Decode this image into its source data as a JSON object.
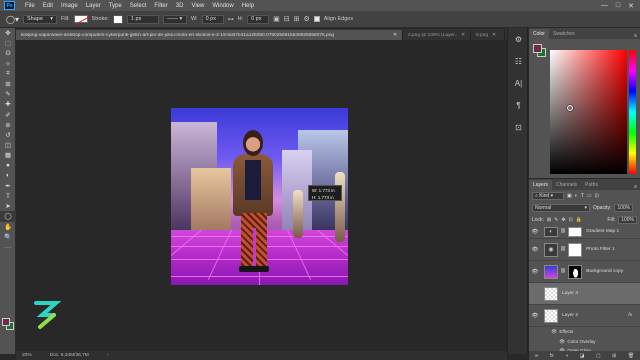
{
  "app": {
    "logo_text": "Ps"
  },
  "menu": {
    "items": [
      "File",
      "Edit",
      "Image",
      "Layer",
      "Type",
      "Select",
      "Filter",
      "3D",
      "View",
      "Window",
      "Help"
    ],
    "window_controls": [
      "—",
      "□",
      "✕"
    ]
  },
  "options": {
    "mode": "Shape",
    "fill_label": "Fill:",
    "stroke_label": "Stroke:",
    "stroke_width": "1 px",
    "w_label": "W:",
    "w_value": "0 px",
    "h_label": "H:",
    "h_value": "0 px",
    "align_edges": "Align Edges"
  },
  "tabs": [
    {
      "label": "kisspng-vaporwave-desktop-computers-cyberpunk-glitch-art-pin-de-jolou-moto-en-stickos-e-2-19-5d47e41a125050.0750256815649925558075.png",
      "active": true
    },
    {
      "label": "2.png @ 100% (Layer...",
      "active": false
    },
    {
      "label": "9.png",
      "active": false
    }
  ],
  "tools": [
    "move-tool",
    "marquee-tool",
    "lasso-tool",
    "quick-select-tool",
    "crop-tool",
    "frame-tool",
    "eyedropper-tool",
    "healing-brush-tool",
    "brush-tool",
    "clone-stamp-tool",
    "history-brush-tool",
    "eraser-tool",
    "gradient-tool",
    "blur-tool",
    "dodge-tool",
    "pen-tool",
    "type-tool",
    "path-select-tool",
    "ellipse-tool",
    "hand-tool",
    "zoom-tool",
    "more-tools"
  ],
  "tool_glyphs": [
    "✥",
    "⬚",
    "ʘ",
    "✧",
    "⌗",
    "⊞",
    "✎",
    "✚",
    "✐",
    "⊛",
    "↺",
    "◫",
    "▦",
    "●",
    "◐",
    "✒",
    "T",
    "➤",
    "◯",
    "✋",
    "🔍",
    "···"
  ],
  "canvas": {
    "transform_readout": {
      "w": "W:  1.773 in",
      "h": "H:  1.773 in"
    }
  },
  "right_strip": [
    "⚙",
    "☷",
    "A|",
    "¶",
    "⊡"
  ],
  "color_panel": {
    "tabs": [
      "Color",
      "Swatches"
    ],
    "foreground": "#6e2b47",
    "background": "#1f6f2e"
  },
  "layers_panel": {
    "tabs": [
      "Layers",
      "Channels",
      "Paths"
    ],
    "kind_label": "Kind",
    "blend_mode": "Normal",
    "opacity_label": "Opacity:",
    "opacity_value": "100%",
    "lock_label": "Lock:",
    "fill_label": "Fill:",
    "fill_value": "100%",
    "layers": [
      {
        "name": "Gradient Map 1",
        "thumb": "adj",
        "mask": true,
        "selected": false,
        "fx": false
      },
      {
        "name": "Photo Filter 1",
        "thumb": "adj",
        "mask": true,
        "selected": false,
        "fx": false
      },
      {
        "name": "Background copy",
        "thumb": "photo",
        "mask": "silhouette",
        "selected": false,
        "fx": false
      },
      {
        "name": "Layer 3",
        "thumb": "checker",
        "mask": false,
        "selected": true,
        "fx": false
      },
      {
        "name": "Layer 2",
        "thumb": "checker",
        "mask": false,
        "selected": false,
        "fx": true
      }
    ],
    "effects_label": "Effects",
    "effects": [
      "Color Overlay",
      "Outer Glow"
    ],
    "fx_label": "fx"
  },
  "status": {
    "zoom": "20%",
    "doc": "Doc: 6,34M/36,7M"
  },
  "bottom_icons": [
    "∞",
    "fx",
    "◑",
    "◪",
    "▢",
    "⊞",
    "🗑"
  ]
}
